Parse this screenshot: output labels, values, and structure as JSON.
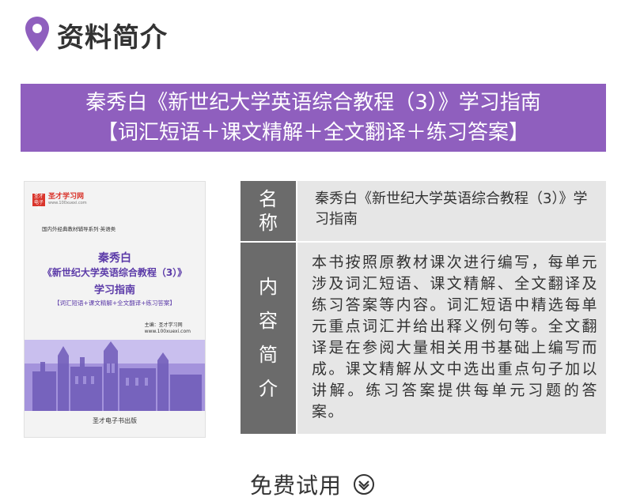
{
  "section": {
    "title": "资料简介",
    "icon": "location-pin-icon",
    "accent": "#8f5fbe"
  },
  "banner": {
    "line1": "秦秀白《新世纪大学英语综合教程（3）》学习指南",
    "line2": "【词汇短语＋课文精解＋全文翻译＋练习答案】"
  },
  "cover": {
    "logo_box": "圣才 电子书",
    "logo_name": "圣才学习网",
    "logo_url": "www.100xuexi.com",
    "series": "国内外经典教材辅导系列·英语类",
    "author": "秦秀白",
    "title": "《新世纪大学英语综合教程（3）》",
    "subtitle": "学习指南",
    "bracket": "【词汇短语+课文精解+全文翻译+练习答案】",
    "editor_line1": "主编：圣才学习网",
    "editor_line2": "www.100xuexi.com",
    "publisher": "圣才电子书出版"
  },
  "table": {
    "name_label_1": "名",
    "name_label_2": "称",
    "name_value": "秦秀白《新世纪大学英语综合教程（3）》学习指南",
    "content_label_1": "内",
    "content_label_2": "容",
    "content_label_3": "简",
    "content_label_4": "介",
    "content_value": "本书按照原教材课次进行编写，每单元涉及词汇短语、课文精解、全文翻译及练习答案等内容。词汇短语中精选每单元重点词汇并给出释义例句等。全文翻译是在参阅大量相关用书基础上编写而成。课文精解从文中选出重点句子加以讲解。练习答案提供每单元习题的答案。"
  },
  "trial": {
    "label": "免费试用",
    "icon": "chevron-down-circle-icon"
  }
}
